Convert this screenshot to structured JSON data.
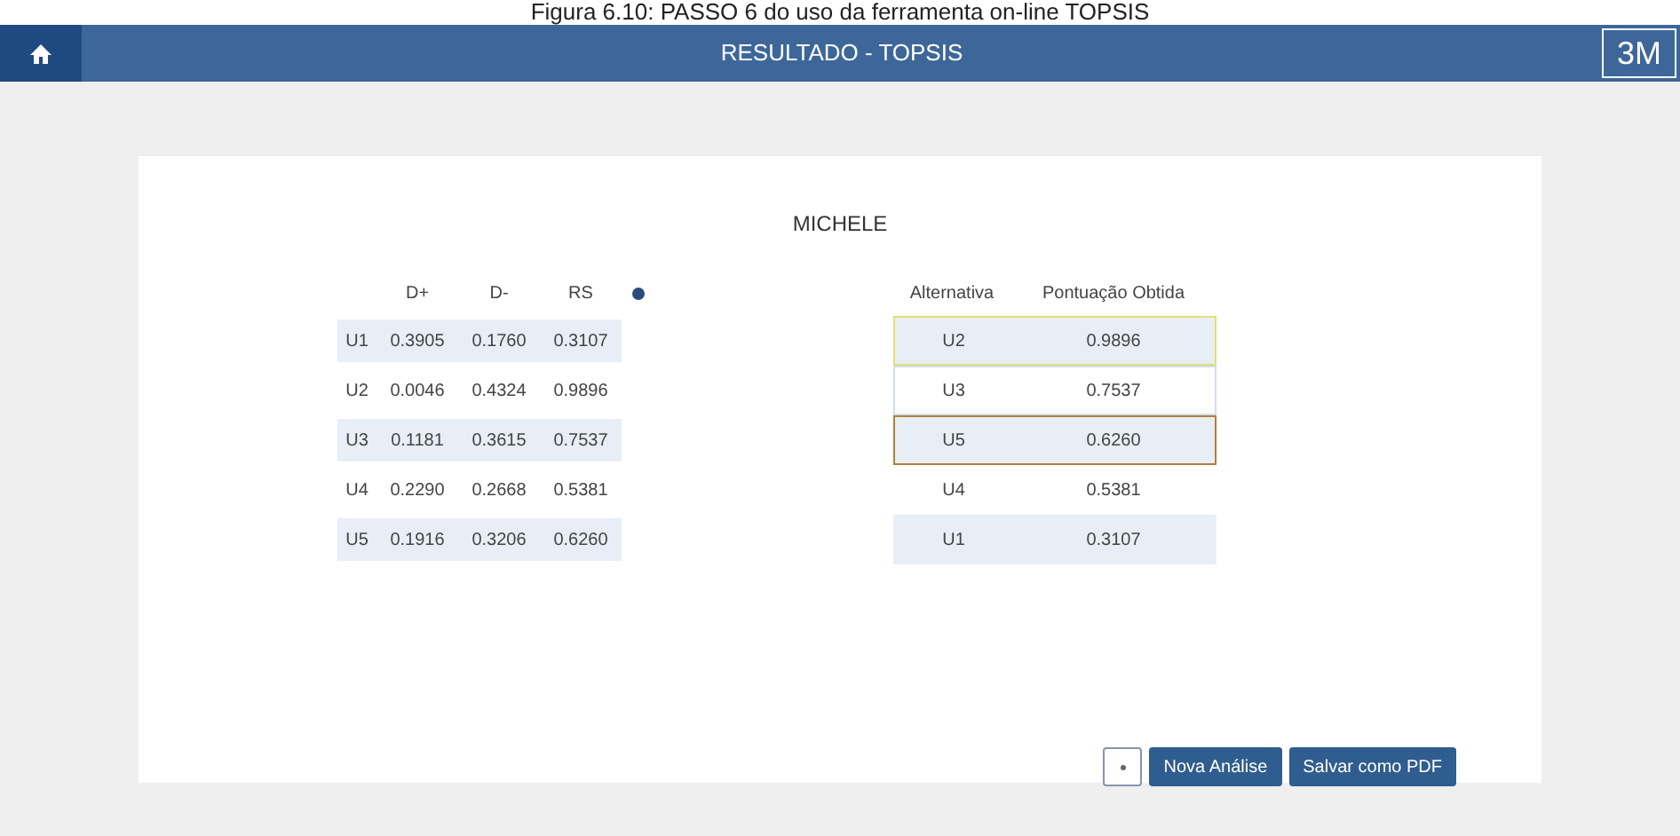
{
  "caption": "Figura 6.10: PASSO 6 do uso da ferramenta on-line TOPSIS",
  "header": {
    "title": "RESULTADO - TOPSIS",
    "logo": "3M"
  },
  "name": "MICHELE",
  "distances": {
    "columns": [
      "D+",
      "D-",
      "RS"
    ],
    "rows": [
      {
        "label": "U1",
        "values": [
          "0.3905",
          "0.1760",
          "0.3107"
        ]
      },
      {
        "label": "U2",
        "values": [
          "0.0046",
          "0.4324",
          "0.9896"
        ]
      },
      {
        "label": "U3",
        "values": [
          "0.1181",
          "0.3615",
          "0.7537"
        ]
      },
      {
        "label": "U4",
        "values": [
          "0.2290",
          "0.2668",
          "0.5381"
        ]
      },
      {
        "label": "U5",
        "values": [
          "0.1916",
          "0.3206",
          "0.6260"
        ]
      }
    ]
  },
  "ranking": {
    "columns": [
      "Alternativa",
      "Pontuação Obtida"
    ],
    "rows": [
      {
        "alternative": "U2",
        "score": "0.9896",
        "color": "#e3df72"
      },
      {
        "alternative": "U3",
        "score": "0.7537",
        "color": "#cfe0f0"
      },
      {
        "alternative": "U5",
        "score": "0.6260",
        "color": "#b57d3c"
      },
      {
        "alternative": "U4",
        "score": "0.5381"
      },
      {
        "alternative": "U1",
        "score": "0.3107"
      }
    ]
  },
  "buttons": [
    "Nova Análise",
    "Salvar como PDF"
  ]
}
